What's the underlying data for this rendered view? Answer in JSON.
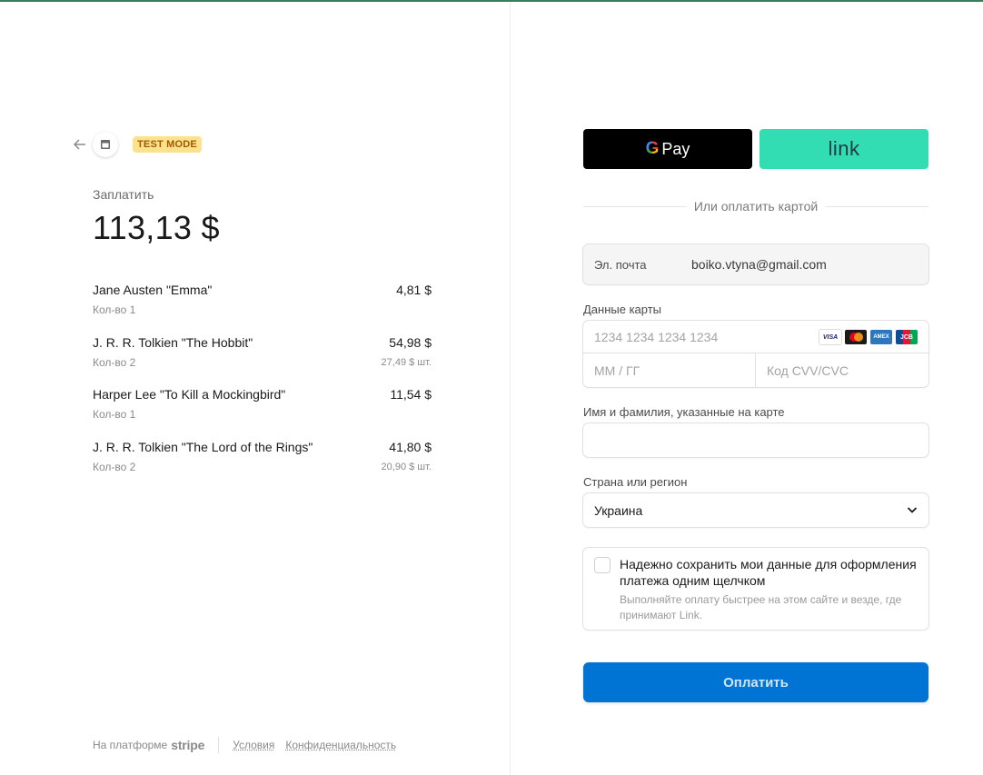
{
  "header": {
    "back_icon": "arrow-left-icon",
    "shop_icon": "store-icon",
    "test_badge": "TEST MODE"
  },
  "summary": {
    "pay_label": "Заплатить",
    "amount": "113,13 $"
  },
  "items": [
    {
      "name": "Jane Austen \"Emma\"",
      "price": "4,81 $",
      "qty": "Кол-во 1",
      "unit_price": ""
    },
    {
      "name": "J. R. R. Tolkien \"The Hobbit\"",
      "price": "54,98 $",
      "qty": "Кол-во 2",
      "unit_price": "27,49 $ шт."
    },
    {
      "name": "Harper Lee \"To Kill a Mockingbird\"",
      "price": "11,54 $",
      "qty": "Кол-во 1",
      "unit_price": ""
    },
    {
      "name": "J. R. R. Tolkien \"The Lord of the Rings\"",
      "price": "41,80 $",
      "qty": "Кол-во 2",
      "unit_price": "20,90 $ шт."
    }
  ],
  "footer": {
    "powered_by": "На платформе",
    "stripe": "stripe",
    "terms": "Условия",
    "privacy": "Конфиденциальность"
  },
  "wallets": {
    "gpay_g": "G",
    "gpay_label": "Pay",
    "link_label": "link"
  },
  "or_pay_card": "Или оплатить картой",
  "email": {
    "label": "Эл. почта",
    "value": "boiko.vtyna@gmail.com"
  },
  "card": {
    "label": "Данные карты",
    "number_placeholder": "1234 1234 1234 1234",
    "expiry_placeholder": "ММ / ГГ",
    "cvc_placeholder": "Код CVV/CVC",
    "brands": [
      "VISA",
      "MC",
      "AMEX",
      "JCB"
    ]
  },
  "cardholder": {
    "label": "Имя и фамилия, указанные на карте",
    "value": ""
  },
  "country": {
    "label": "Страна или регион",
    "value": "Украина"
  },
  "save": {
    "title": "Надежно сохранить мои данные для оформления платежа одним щелчком",
    "description": "Выполняйте оплату быстрее на этом сайте и везде, где принимают Link."
  },
  "pay_button": "Оплатить",
  "colors": {
    "accent": "#0074d4",
    "link": "#33ddb3",
    "test_badge": "#fde28e"
  }
}
